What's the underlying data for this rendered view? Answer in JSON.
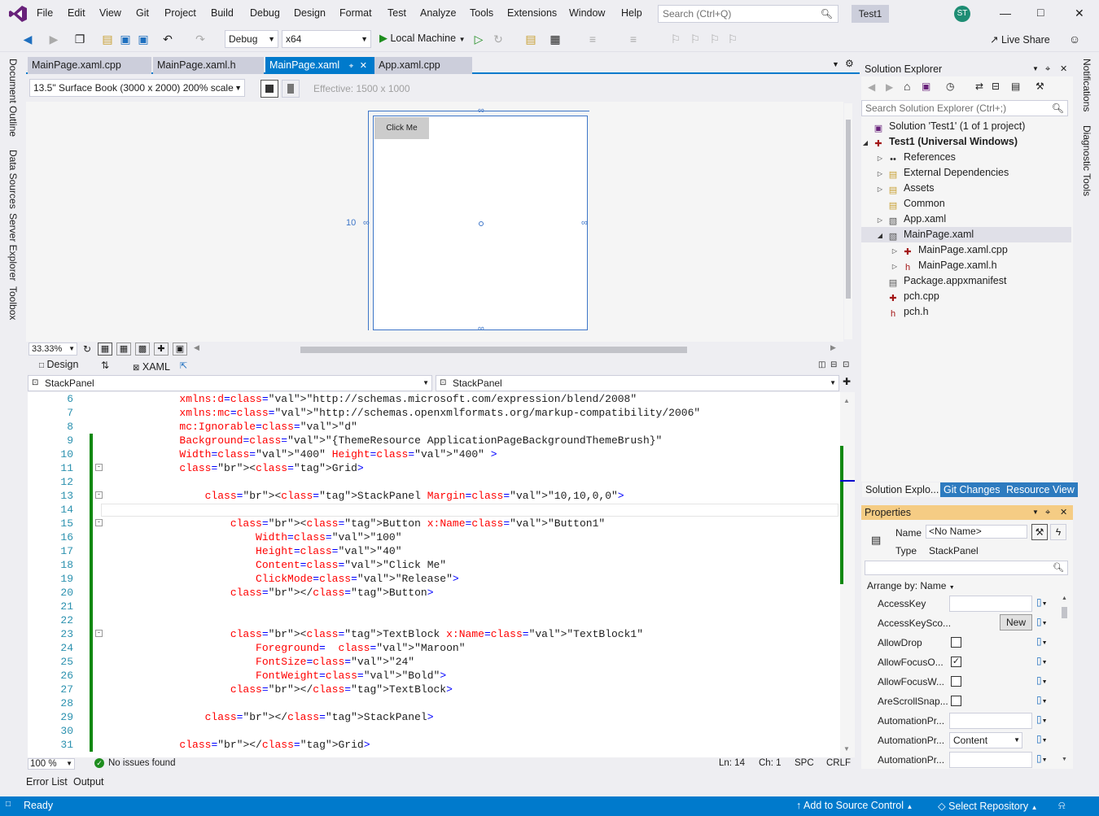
{
  "menu": [
    "File",
    "Edit",
    "View",
    "Git",
    "Project",
    "Build",
    "Debug",
    "Design",
    "Format",
    "Test",
    "Analyze",
    "Tools",
    "Extensions",
    "Window",
    "Help"
  ],
  "search": {
    "placeholder": "Search (Ctrl+Q)"
  },
  "solution_badge": "Test1",
  "avatar_initials": "ST",
  "toolbar": {
    "config": "Debug",
    "platform": "x64",
    "run_target": "Local Machine",
    "live_share": "Live Share"
  },
  "left_tabs": [
    "Document Outline",
    "Data Sources",
    "Server Explorer",
    "Toolbox"
  ],
  "right_tabs": [
    "Notifications",
    "Diagnostic Tools"
  ],
  "doc_tabs": [
    "MainPage.xaml.cpp",
    "MainPage.xaml.h",
    "MainPage.xaml",
    "App.xaml.cpp"
  ],
  "designer": {
    "device": "13.5\" Surface Book (3000 x 2000) 200% scale",
    "effective": "Effective: 1500 x 1000",
    "button_text": "Click Me",
    "margin_label": "10",
    "zoom": "33.33%"
  },
  "view_tabs": {
    "design": "Design",
    "xaml": "XAML"
  },
  "nav": {
    "left": "StackPanel",
    "right": "StackPanel"
  },
  "code_lines": [
    {
      "n": "6",
      "t": "        xmlns:d=\"http://schemas.microsoft.com/expression/blend/2008\""
    },
    {
      "n": "7",
      "t": "        xmlns:mc=\"http://schemas.openxmlformats.org/markup-compatibility/2006\""
    },
    {
      "n": "8",
      "t": "        mc:Ignorable=\"d\""
    },
    {
      "n": "9",
      "t": "        Background=\"{ThemeResource ApplicationPageBackgroundThemeBrush}\""
    },
    {
      "n": "10",
      "t": "        Width=\"400\" Height=\"400\" >"
    },
    {
      "n": "11",
      "t": "        <Grid>"
    },
    {
      "n": "12",
      "t": ""
    },
    {
      "n": "13",
      "t": "            <StackPanel Margin=\"10,10,0,0\">"
    },
    {
      "n": "14",
      "t": ""
    },
    {
      "n": "15",
      "t": "                <Button x:Name=\"Button1\""
    },
    {
      "n": "16",
      "t": "                    Width=\"100\""
    },
    {
      "n": "17",
      "t": "                    Height=\"40\""
    },
    {
      "n": "18",
      "t": "                    Content=\"Click Me\""
    },
    {
      "n": "19",
      "t": "                    ClickMode=\"Release\">"
    },
    {
      "n": "20",
      "t": "                </Button>"
    },
    {
      "n": "21",
      "t": ""
    },
    {
      "n": "22",
      "t": ""
    },
    {
      "n": "23",
      "t": "                <TextBlock x:Name=\"TextBlock1\""
    },
    {
      "n": "24",
      "t": "                    Foreground=  \"Maroon\""
    },
    {
      "n": "25",
      "t": "                    FontSize=\"24\""
    },
    {
      "n": "26",
      "t": "                    FontWeight=\"Bold\">"
    },
    {
      "n": "27",
      "t": "                </TextBlock>"
    },
    {
      "n": "28",
      "t": ""
    },
    {
      "n": "29",
      "t": "            </StackPanel>"
    },
    {
      "n": "30",
      "t": ""
    },
    {
      "n": "31",
      "t": "        </Grid>"
    }
  ],
  "editor_status": {
    "zoom": "100 %",
    "issues": "No issues found",
    "line": "Ln: 14",
    "col": "Ch: 1",
    "spc": "SPC",
    "eol": "CRLF"
  },
  "solution_explorer": {
    "title": "Solution Explorer",
    "search_placeholder": "Search Solution Explorer (Ctrl+;)",
    "items": [
      {
        "label": "Solution 'Test1' (1 of 1 project)",
        "bold": false
      },
      {
        "label": "Test1 (Universal Windows)",
        "bold": true
      },
      {
        "label": "References",
        "bold": false
      },
      {
        "label": "External Dependencies",
        "bold": false
      },
      {
        "label": "Assets",
        "bold": false
      },
      {
        "label": "Common",
        "bold": false
      },
      {
        "label": "App.xaml",
        "bold": false
      },
      {
        "label": "MainPage.xaml",
        "bold": false
      },
      {
        "label": "MainPage.xaml.cpp",
        "bold": false
      },
      {
        "label": "MainPage.xaml.h",
        "bold": false
      },
      {
        "label": "Package.appxmanifest",
        "bold": false
      },
      {
        "label": "pch.cpp",
        "bold": false
      },
      {
        "label": "pch.h",
        "bold": false
      }
    ],
    "tabs": [
      "Solution Explo...",
      "Git Changes",
      "Resource View"
    ]
  },
  "properties": {
    "title": "Properties",
    "name_label": "Name",
    "name_value": "<No Name>",
    "type_label": "Type",
    "type_value": "StackPanel",
    "arrange": "Arrange by: Name",
    "rows": [
      {
        "label": "AccessKey",
        "kind": "input",
        "value": ""
      },
      {
        "label": "AccessKeySco...",
        "kind": "button",
        "value": "New"
      },
      {
        "label": "AllowDrop",
        "kind": "check",
        "value": ""
      },
      {
        "label": "AllowFocusO...",
        "kind": "check",
        "value": "✓"
      },
      {
        "label": "AllowFocusW...",
        "kind": "check",
        "value": ""
      },
      {
        "label": "AreScrollSnap...",
        "kind": "check",
        "value": ""
      },
      {
        "label": "AutomationPr...",
        "kind": "input",
        "value": ""
      },
      {
        "label": "AutomationPr...",
        "kind": "select",
        "value": "Content"
      },
      {
        "label": "AutomationPr...",
        "kind": "input",
        "value": ""
      }
    ]
  },
  "bottom_tabs": [
    "Error List",
    "Output"
  ],
  "status": {
    "state": "Ready",
    "source_control": "Add to Source Control",
    "repo": "Select Repository"
  }
}
